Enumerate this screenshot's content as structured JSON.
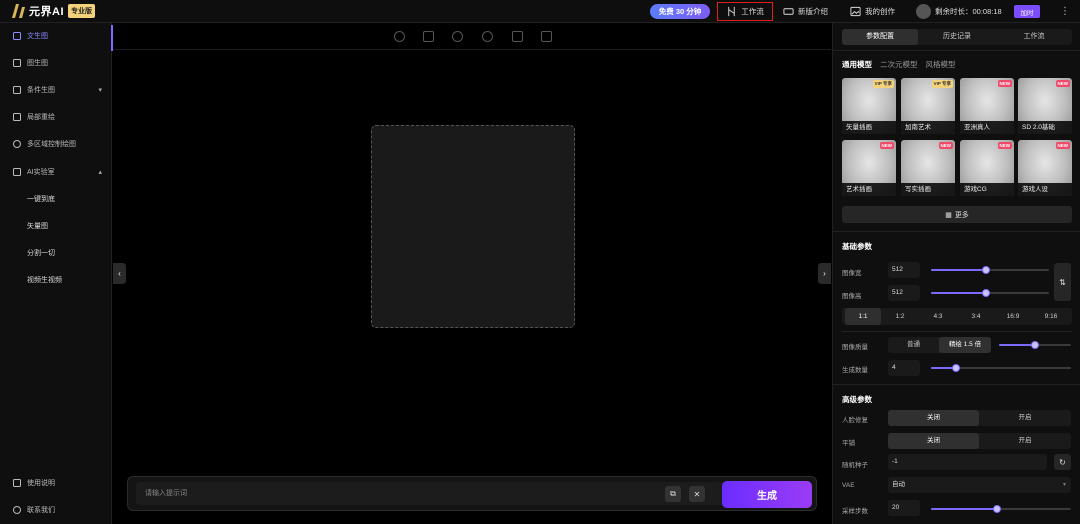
{
  "brand": {
    "logo_text": "元界AI",
    "badge": "专业版"
  },
  "topbar": {
    "free_badge": "免费 30 分钟",
    "workflow": "工作流",
    "new_intro": "新版介绍",
    "my_works": "我的创作",
    "remaining": "剩余时长：00:08:18",
    "recharge": "加时",
    "more": "⋮"
  },
  "sidebar": {
    "items": [
      {
        "label": "文生图",
        "icon": "text-image-icon"
      },
      {
        "label": "图生图",
        "icon": "image-image-icon"
      },
      {
        "label": "条件生图",
        "icon": "condition-icon"
      },
      {
        "label": "局部重绘",
        "icon": "inpaint-icon"
      },
      {
        "label": "多区域控制绘图",
        "icon": "multi-region-icon"
      },
      {
        "label": "AI实验室",
        "icon": "lab-icon"
      },
      {
        "label": "一键到底"
      },
      {
        "label": "矢量图"
      },
      {
        "label": "分割一切"
      },
      {
        "label": "视频生视频"
      },
      {
        "label": "使用说明",
        "icon": "help-icon"
      },
      {
        "label": "联系我们",
        "icon": "headset-icon"
      }
    ]
  },
  "prompt": {
    "placeholder": "请输入提示词",
    "generate": "生成"
  },
  "panel": {
    "tabs": [
      "参数配置",
      "历史记录",
      "工作流"
    ],
    "model_tabs": [
      "通用模型",
      "二次元模型",
      "风格模型"
    ],
    "models": [
      {
        "label": "矢量插画",
        "tag": "VIP 专享",
        "tag_type": "vip"
      },
      {
        "label": "加南艺术",
        "tag": "VIP 专享",
        "tag_type": "vip"
      },
      {
        "label": "亚洲真人",
        "tag": "NEW",
        "tag_type": "new"
      },
      {
        "label": "SD 2.0基础",
        "tag": "NEW",
        "tag_type": "new"
      },
      {
        "label": "艺术插画",
        "tag": "NEW",
        "tag_type": "new"
      },
      {
        "label": "写实插画",
        "tag": "NEW",
        "tag_type": "new"
      },
      {
        "label": "游戏CG",
        "tag": "NEW",
        "tag_type": "new"
      },
      {
        "label": "游戏人设",
        "tag": "NEW",
        "tag_type": "new"
      }
    ],
    "more_models": "更多",
    "basic": {
      "title": "基础参数",
      "width_label": "图像宽",
      "width": "512",
      "width_pct": 0.47,
      "height_label": "图像高",
      "height": "512",
      "height_pct": 0.47,
      "ratios": [
        "1:1",
        "1:2",
        "4:3",
        "3:4",
        "16:9",
        "9:16"
      ],
      "quality_label": "图像质量",
      "quality_options": [
        "普通",
        "精绘 1.5 倍"
      ],
      "quality_pct": 0.5,
      "count_label": "生成数量",
      "count": "4",
      "count_pct": 0.18
    },
    "advanced": {
      "title": "高级参数",
      "face_fix_label": "人脸修复",
      "face_fix": [
        "关闭",
        "开启"
      ],
      "tiling_label": "平铺",
      "tiling": [
        "关闭",
        "开启"
      ],
      "seed_label": "随机种子",
      "seed": "-1",
      "vae_label": "VAE",
      "vae": "自动",
      "steps_label": "采样步数",
      "steps": "20",
      "steps_pct": 0.47
    }
  }
}
